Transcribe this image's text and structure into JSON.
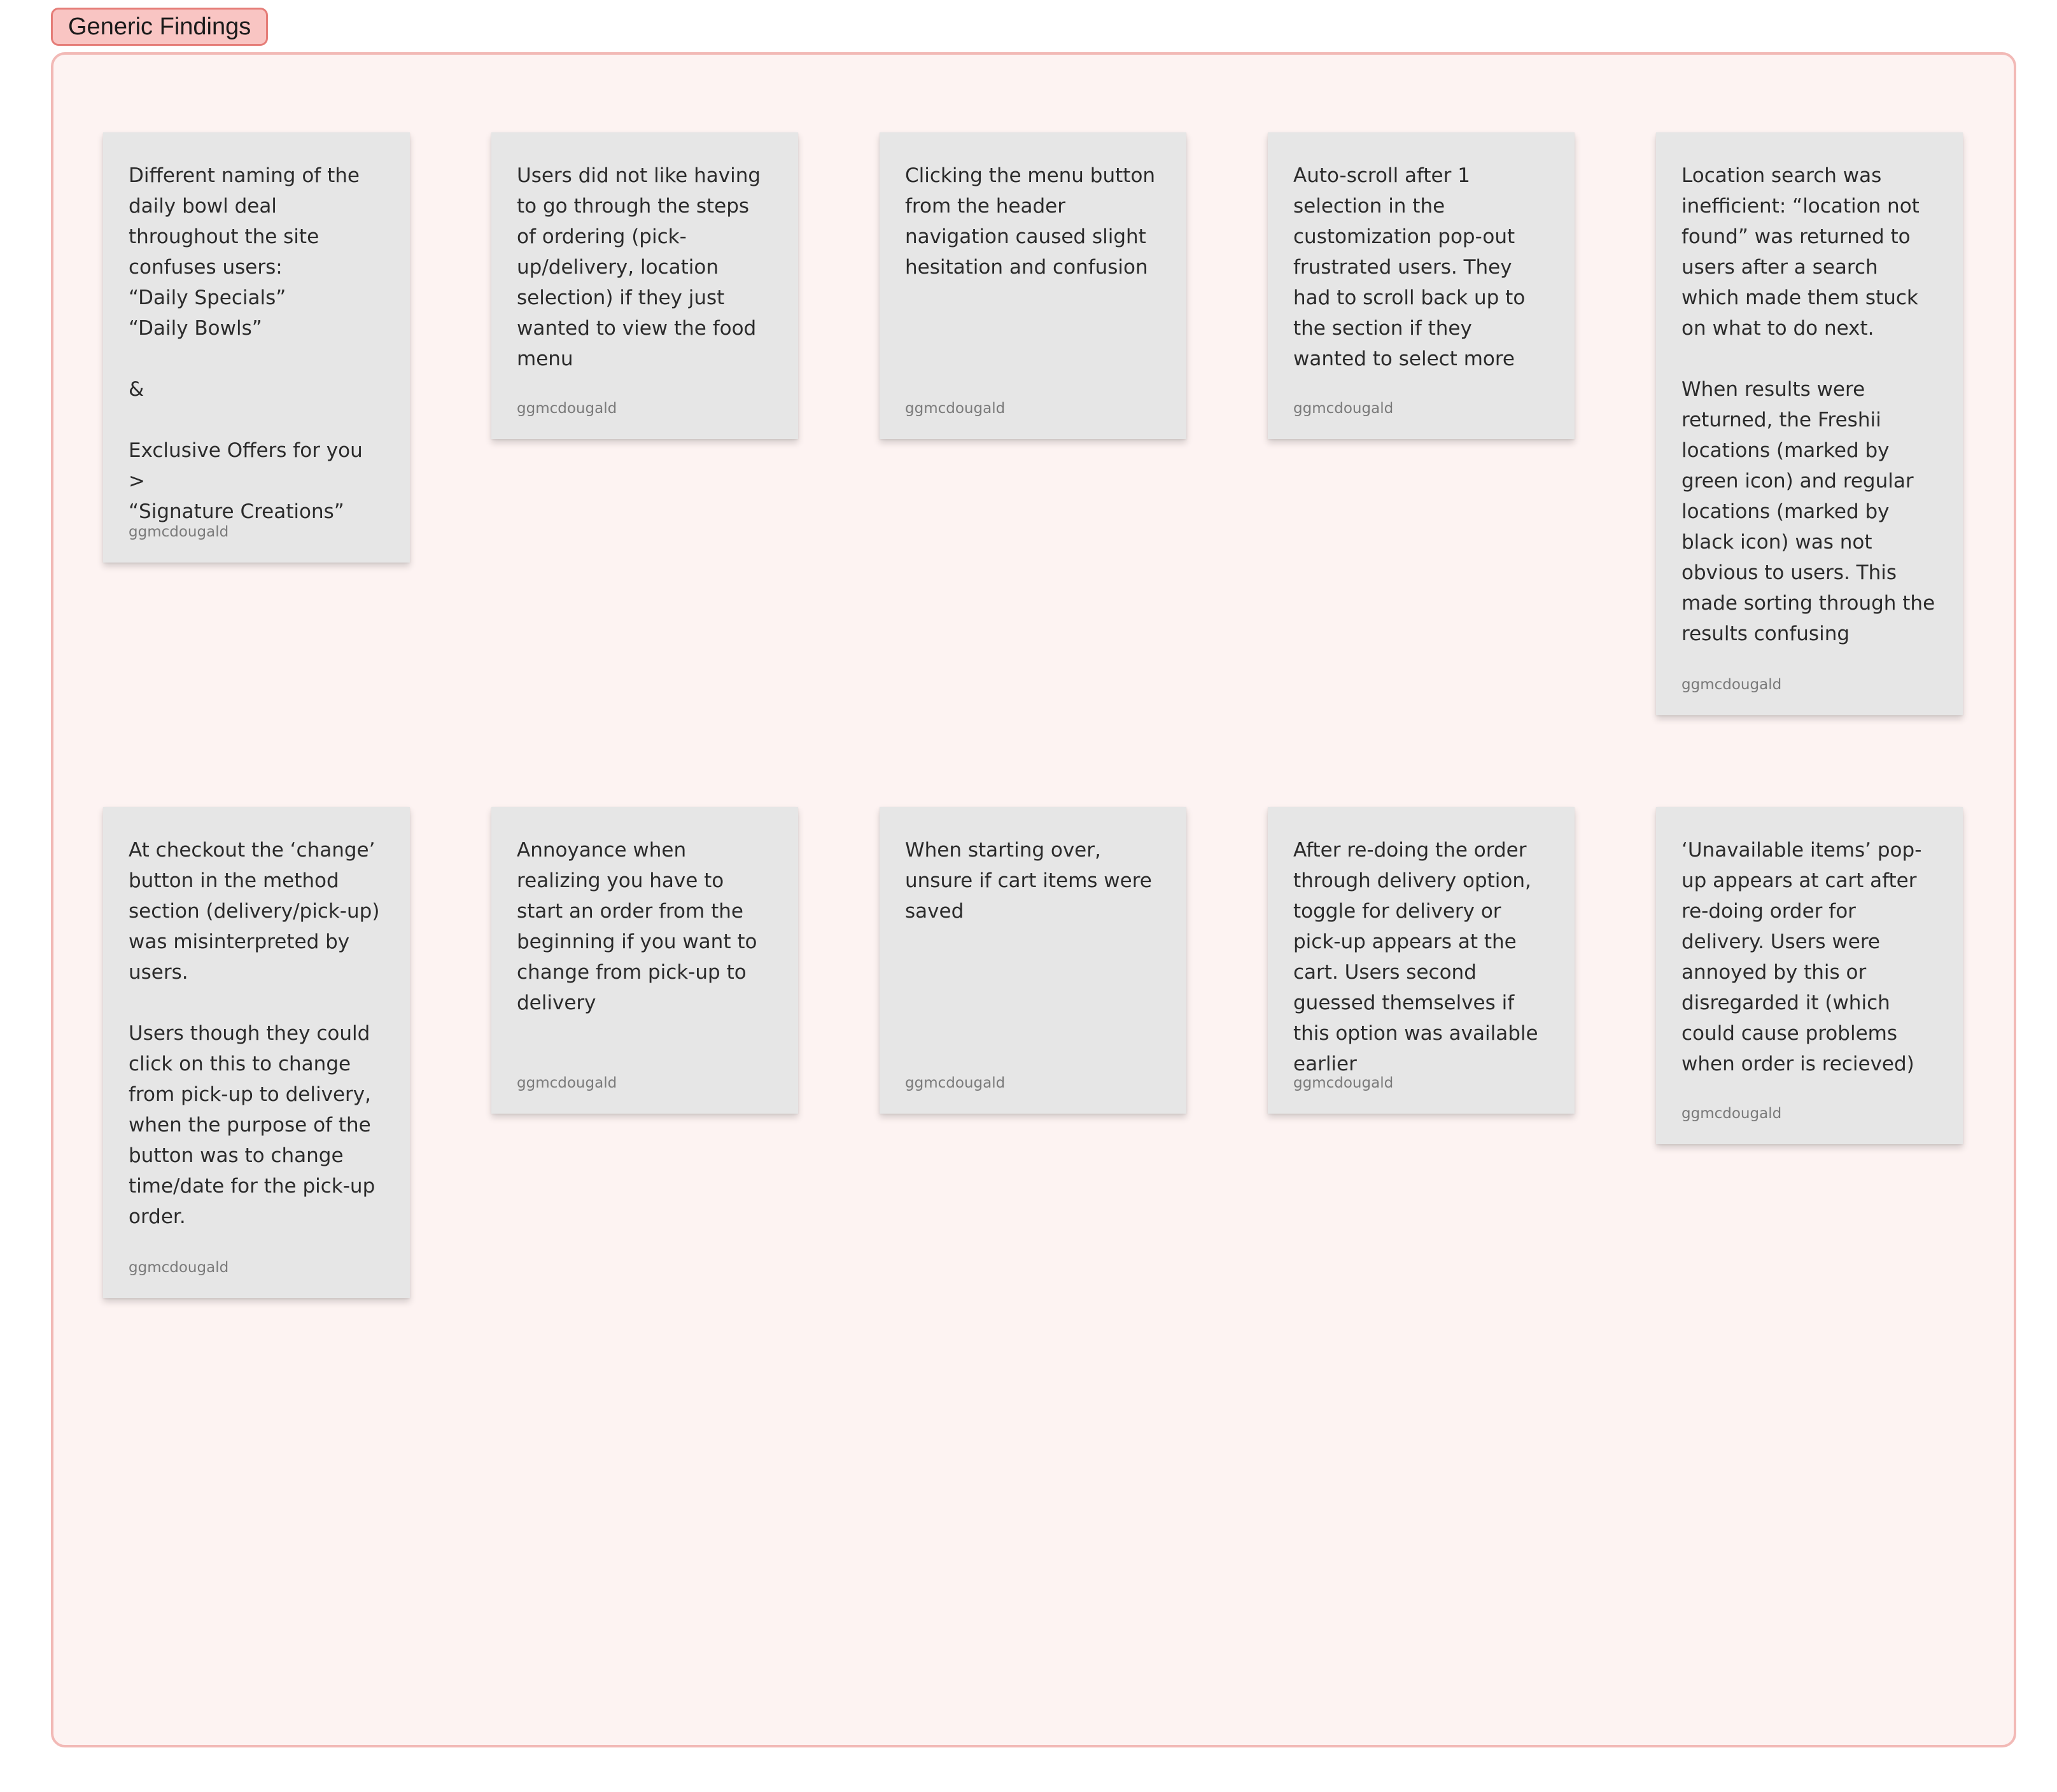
{
  "section": {
    "title": "Generic Findings"
  },
  "stickies": [
    {
      "text": "Different naming of the daily bowl deal throughout the site confuses users:\n“Daily Specials”\n“Daily Bowls”\n\n&\n\nExclusive Offers for you >\n“Signature Creations”",
      "author": "ggmcdougald"
    },
    {
      "text": "Users did not like having to go through the steps of ordering (pick-up/delivery, location selection) if they just wanted to view the food menu",
      "author": "ggmcdougald"
    },
    {
      "text": "Clicking the menu button from the header navigation caused slight hesitation and confusion",
      "author": "ggmcdougald"
    },
    {
      "text": "Auto-scroll after 1 selection in the customization pop-out frustrated users. They had to scroll back up to the section if they wanted to select more",
      "author": "ggmcdougald"
    },
    {
      "text": "Location search was inefficient: “location not found” was returned to users after a search which made them stuck on what to do next.\n\nWhen results were returned, the Freshii locations (marked by green icon) and regular locations (marked by black icon) was not obvious to users. This made sorting through the results confusing",
      "author": "ggmcdougald"
    },
    {
      "text": "At checkout the ‘change’ button in the method section (delivery/pick-up) was misinterpreted by users.\n\nUsers though they could click on this to change from pick-up to delivery, when the purpose of the button was to change time/date for the pick-up order.",
      "author": "ggmcdougald"
    },
    {
      "text": "Annoyance when realizing you have to start an order from the beginning if you want to change from pick-up to delivery",
      "author": "ggmcdougald"
    },
    {
      "text": "When starting over, unsure if cart items were saved",
      "author": "ggmcdougald"
    },
    {
      "text": "After re-doing the order through delivery option, toggle for delivery or pick-up appears at the cart. Users second guessed themselves if this option was available earlier",
      "author": "ggmcdougald"
    },
    {
      "text": "‘Unavailable items’ pop-up appears at cart after re-doing order for delivery. Users were annoyed by this or disregarded it (which could cause problems when order is recieved)",
      "author": "ggmcdougald"
    }
  ]
}
